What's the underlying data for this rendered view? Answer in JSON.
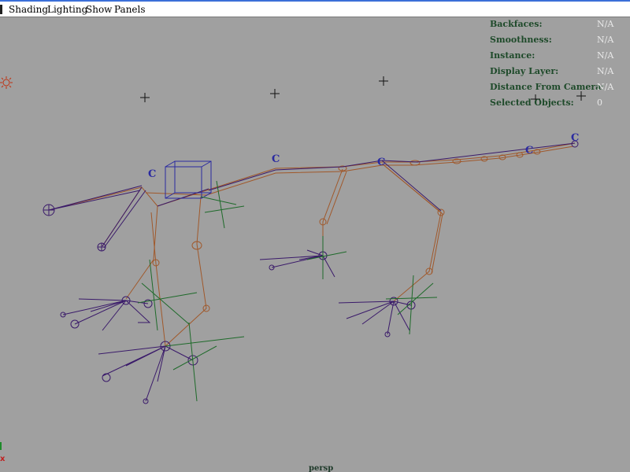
{
  "menubar": {
    "items": [
      "Shading",
      "Lighting",
      "Show",
      "Panels"
    ]
  },
  "hud": {
    "rows": [
      {
        "label": "Backfaces:",
        "value": "N/A"
      },
      {
        "label": "Smoothness:",
        "value": "N/A"
      },
      {
        "label": "Instance:",
        "value": "N/A"
      },
      {
        "label": "Display Layer:",
        "value": "N/A"
      },
      {
        "label": "Distance From Camera:",
        "value": "N/A"
      },
      {
        "label": "Selected Objects:",
        "value": "0"
      }
    ]
  },
  "viewport": {
    "camera_name": "persp",
    "axis_label": "x",
    "constraint_marker": "C"
  },
  "colors": {
    "viewport_bg": "#a0a0a0",
    "bone": "#a0582a",
    "joint_wire": "#3a1a6a",
    "locator": "#1e6a2a",
    "control_box": "#2a2aa0",
    "hud_label": "#1e4a2a",
    "hud_value": "#e8e8e8",
    "light_icon": "#c03010"
  },
  "icons": [
    "sun-light-icon",
    "camera-locator-icon"
  ]
}
